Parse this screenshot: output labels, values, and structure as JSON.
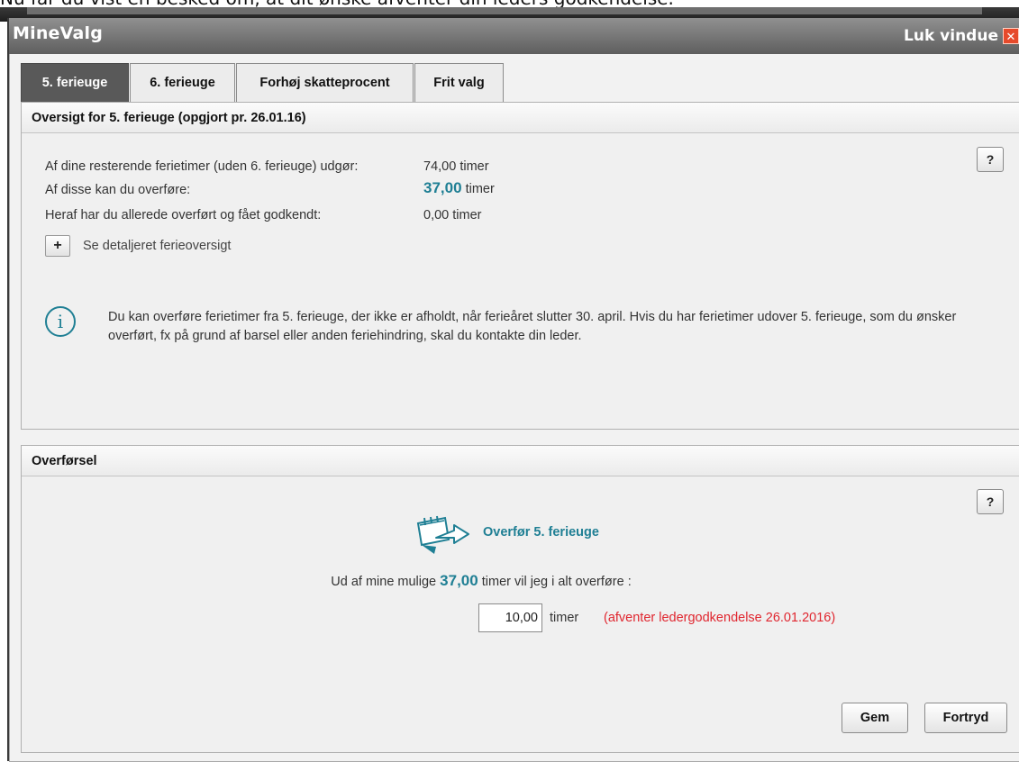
{
  "caption": "Nu får du vist en besked om, at dit ønske afventer din leders godkendelse.",
  "window": {
    "title": "MineValg",
    "close_label": "Luk vindue",
    "close_glyph": "✕"
  },
  "tabs": [
    {
      "label": "5. ferieuge",
      "active": true
    },
    {
      "label": "6. ferieuge",
      "active": false
    },
    {
      "label": "Forhøj skatteprocent",
      "active": false
    },
    {
      "label": "Frit valg",
      "active": false
    }
  ],
  "overview": {
    "heading": "Oversigt for 5. ferieuge (opgjort pr. 26.01.16)",
    "help_label": "?",
    "rows": [
      {
        "label": "Af dine resterende ferietimer (uden 6. ferieuge) udgør:",
        "value": "74,00",
        "unit": "timer"
      },
      {
        "label": "Af disse kan du overføre:",
        "value": "37,00",
        "unit": "timer"
      },
      {
        "label": "Heraf har du allerede overført og fået godkendt:",
        "value": "0,00",
        "unit": "timer"
      }
    ],
    "expand_label": "+",
    "detail_link": "Se detaljeret ferieoversigt",
    "info_glyph": "i",
    "info_text": "Du kan overføre ferietimer fra 5. ferieuge, der ikke er afholdt, når ferieåret slutter 30. april. Hvis du har ferietimer udover 5. ferieuge, som du ønsker overført, fx på grund af barsel eller anden feriehindring, skal du kontakte din leder."
  },
  "transfer": {
    "heading": "Overførsel",
    "help_label": "?",
    "title": "Overfør 5. ferieuge",
    "prompt_pre": "Ud af mine mulige",
    "prompt_value": "37,00",
    "prompt_post": "timer vil jeg i alt overføre :",
    "amount_value": "10,00",
    "amount_unit": "timer",
    "pending_status": "(afventer ledergodkendelse 26.01.2016)",
    "save_label": "Gem",
    "cancel_label": "Fortryd"
  },
  "colors": {
    "accent": "#1f7f94",
    "pending": "#e0262f",
    "active_tab": "#595959",
    "close": "#e64a2b"
  }
}
